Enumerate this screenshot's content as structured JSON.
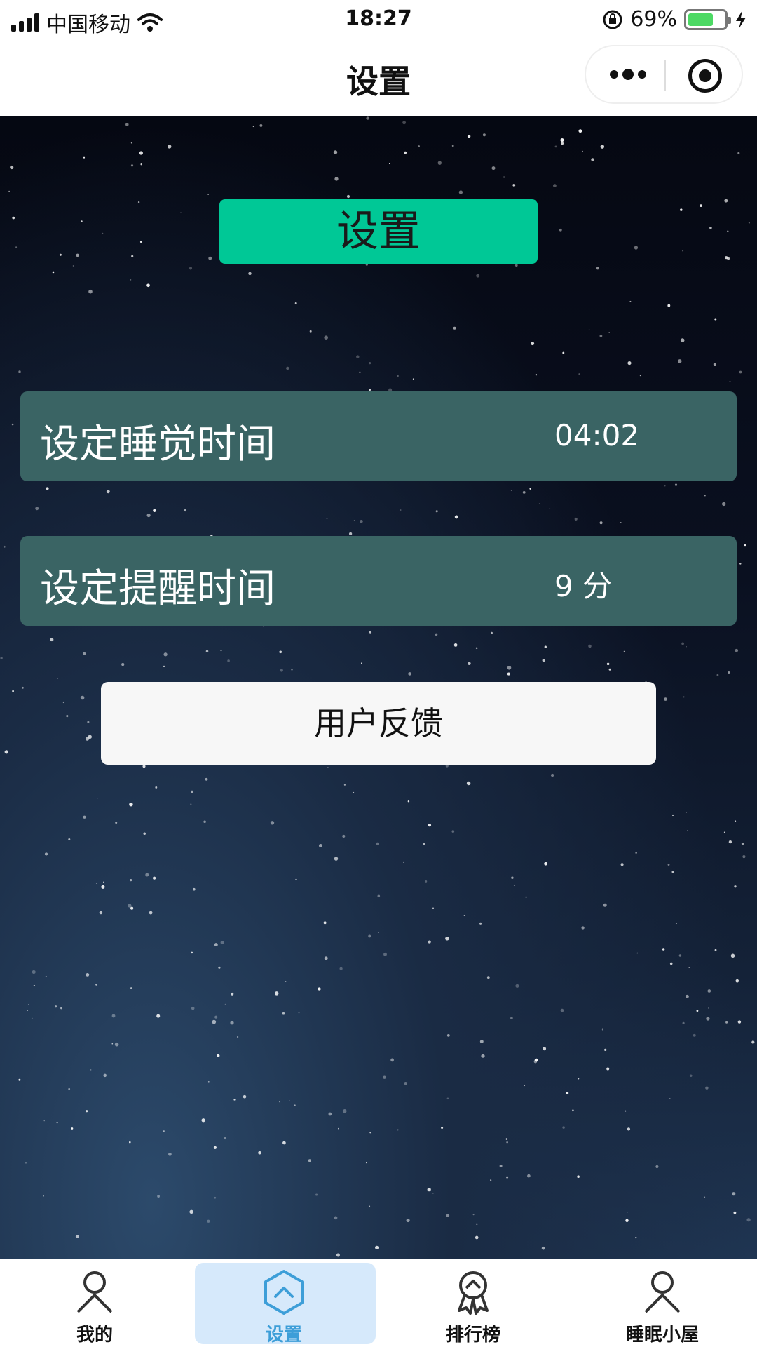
{
  "status_bar": {
    "carrier": "中国移动",
    "time": "18:27",
    "battery_percent": "69%",
    "battery_level": 0.69,
    "icons": [
      "signal-icon",
      "wifi-icon",
      "rotation-lock-icon",
      "battery-icon",
      "charging-icon"
    ]
  },
  "nav": {
    "title": "设置",
    "icons": [
      "more-icon",
      "close-target-icon"
    ]
  },
  "main": {
    "header_label": "设置",
    "rows": [
      {
        "label": "设定睡觉时间",
        "value": "04:02"
      },
      {
        "label": "设定提醒时间",
        "value": "9 分"
      }
    ],
    "feedback_label": "用户反馈"
  },
  "tabs": [
    {
      "label": "我的",
      "icon": "person-icon"
    },
    {
      "label": "设置",
      "icon": "hexagon-up-icon"
    },
    {
      "label": "排行榜",
      "icon": "medal-icon"
    },
    {
      "label": "睡眠小屋",
      "icon": "person-icon"
    }
  ],
  "colors": {
    "accent": "#00c896",
    "row_bg": "#3a6464",
    "active_tab_bg": "#d6e9fb",
    "active_tab_text": "#3d9ed8"
  }
}
